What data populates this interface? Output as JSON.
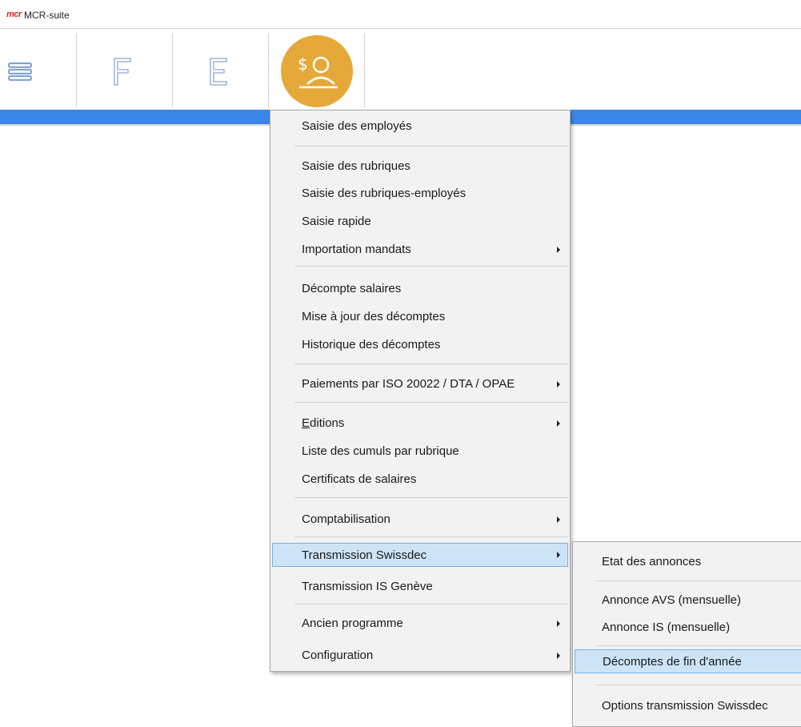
{
  "app": {
    "logo_text": "mcr",
    "title": "MCR-suite"
  },
  "toolbar": {
    "buttons": [
      {
        "icon": "menu-icon"
      },
      {
        "icon": "letter-f-icon",
        "glyph": "F"
      },
      {
        "icon": "letter-e-icon",
        "glyph": "E"
      },
      {
        "icon": "salary-person-icon",
        "glyph": "$",
        "accent": "#e5a93a"
      }
    ]
  },
  "colors": {
    "header_bar": "#3a86e8",
    "menu_bg": "#f2f2f2",
    "highlight": "#cde4f7"
  },
  "menu": {
    "items": [
      {
        "label": "Saisie des employés",
        "has_submenu": false
      },
      {
        "label": "Saisie des rubriques",
        "has_submenu": false
      },
      {
        "label": "Saisie des rubriques-employés",
        "has_submenu": false
      },
      {
        "label": "Saisie rapide",
        "has_submenu": false
      },
      {
        "label": "Importation mandats",
        "has_submenu": true
      },
      {
        "label": "Décompte salaires",
        "has_submenu": false
      },
      {
        "label": "Mise à jour des décomptes",
        "has_submenu": false
      },
      {
        "label": "Historique des décomptes",
        "has_submenu": false
      },
      {
        "label": "Paiements par ISO 20022 / DTA / OPAE",
        "has_submenu": true
      },
      {
        "label_first": "E",
        "label_rest": "ditions",
        "has_submenu": true
      },
      {
        "label": "Liste des cumuls par rubrique",
        "has_submenu": false
      },
      {
        "label": "Certificats de salaires",
        "has_submenu": false
      },
      {
        "label": "Comptabilisation",
        "has_submenu": true
      },
      {
        "label": "Transmission Swissdec",
        "has_submenu": true,
        "highlighted": true
      },
      {
        "label": "Transmission IS Genève",
        "has_submenu": false
      },
      {
        "label": "Ancien programme",
        "has_submenu": true
      },
      {
        "label": "Configuration",
        "has_submenu": true
      }
    ]
  },
  "submenu": {
    "items": [
      {
        "label": "Etat des annonces"
      },
      {
        "label": "Annonce AVS (mensuelle)"
      },
      {
        "label": "Annonce IS (mensuelle)"
      },
      {
        "label": "Décomptes de fin d'année",
        "highlighted": true
      },
      {
        "label": "Options transmission Swissdec"
      }
    ]
  }
}
